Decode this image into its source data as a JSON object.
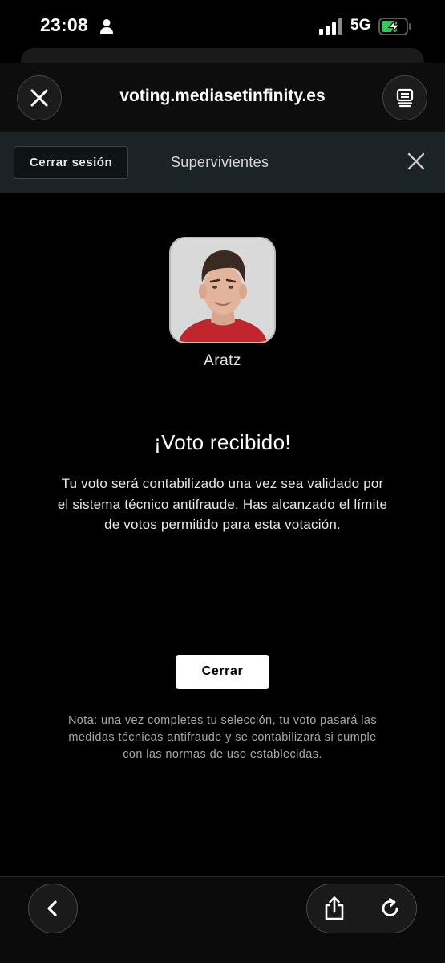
{
  "status_bar": {
    "time": "23:08",
    "network": "5G",
    "icons": [
      "person-icon",
      "signal-icon",
      "battery-charging-icon"
    ]
  },
  "browser": {
    "url": "voting.mediasetinfinity.es",
    "icons": [
      "close-icon",
      "tabs-icon"
    ]
  },
  "toolbar": {
    "logout_label": "Cerrar sesión",
    "title": "Supervivientes",
    "close_icon": "close-icon"
  },
  "candidate": {
    "name": "Aratz",
    "photo_icon": "candidate-photo"
  },
  "confirmation": {
    "title": "¡Voto recibido!",
    "message": "Tu voto será contabilizado una vez sea validado por el sistema técnico antifraude. Has alcanzado el límite de votos permitido para esta votación.",
    "close_label": "Cerrar"
  },
  "note": "Nota: una vez completes tu selección, tu voto pasará las medidas técnicas antifraude y se contabilizará si cumple con las normas de uso establecidas.",
  "bottom_bar": {
    "icons": [
      "back-chevron-icon",
      "share-icon",
      "reload-icon"
    ]
  },
  "colors": {
    "background": "#000000",
    "toolbar": "#1b2326",
    "button_white": "#ffffff",
    "note_text": "#a8a8a8",
    "battery_green": "#34c759"
  }
}
